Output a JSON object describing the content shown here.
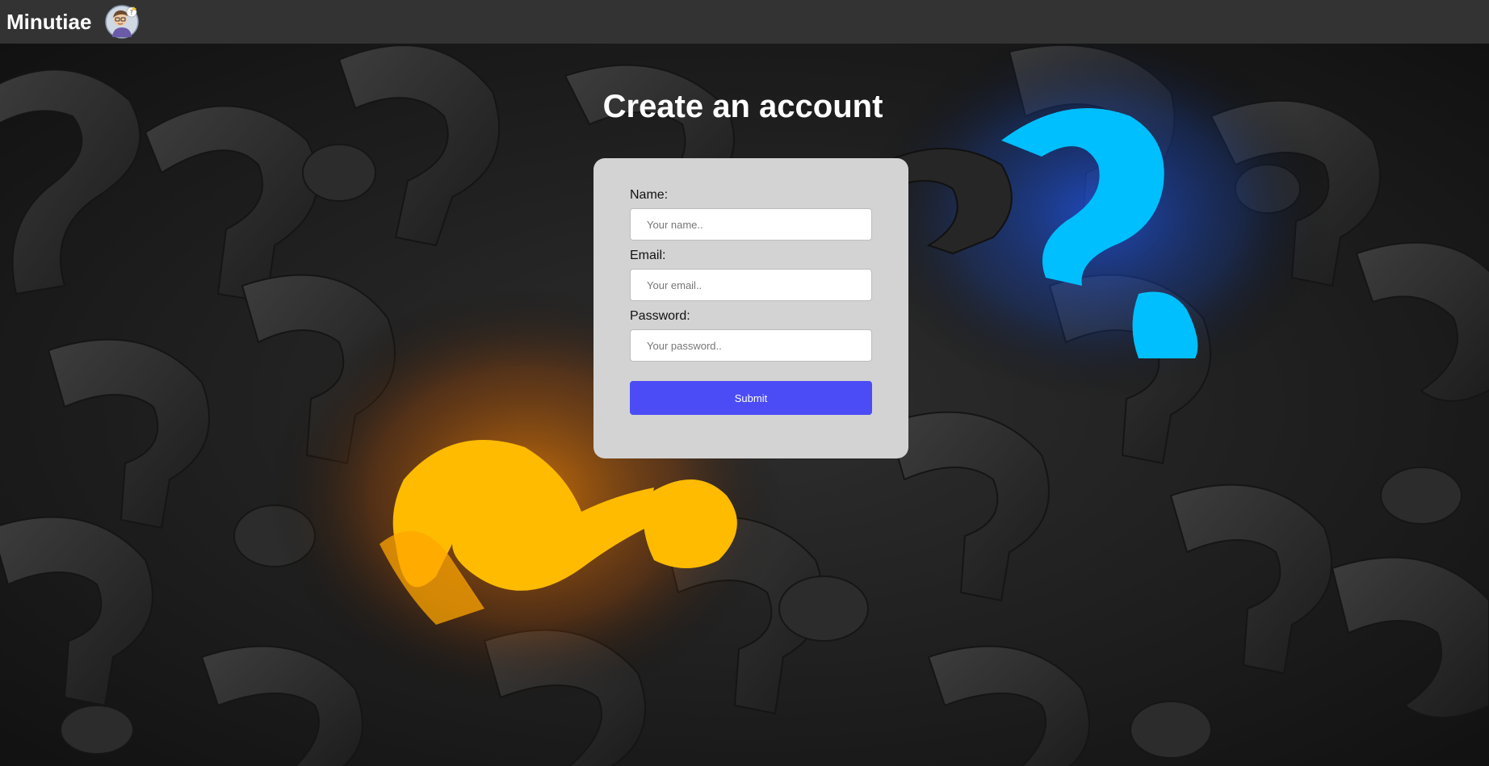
{
  "header": {
    "brand": "Minutiae",
    "avatar_icon": "cartoon-avatar-icon"
  },
  "main": {
    "title": "Create an account"
  },
  "form": {
    "name_label": "Name:",
    "name_placeholder": "Your name..",
    "name_value": "",
    "email_label": "Email:",
    "email_placeholder": "Your email..",
    "email_value": "",
    "password_label": "Password:",
    "password_placeholder": "Your password..",
    "password_value": "",
    "submit_label": "Submit"
  },
  "colors": {
    "topbar": "#333333",
    "card": "#d3d3d3",
    "submit": "#4b4cf5",
    "accent_orange": "#ffbb00",
    "accent_blue": "#00bfff"
  }
}
